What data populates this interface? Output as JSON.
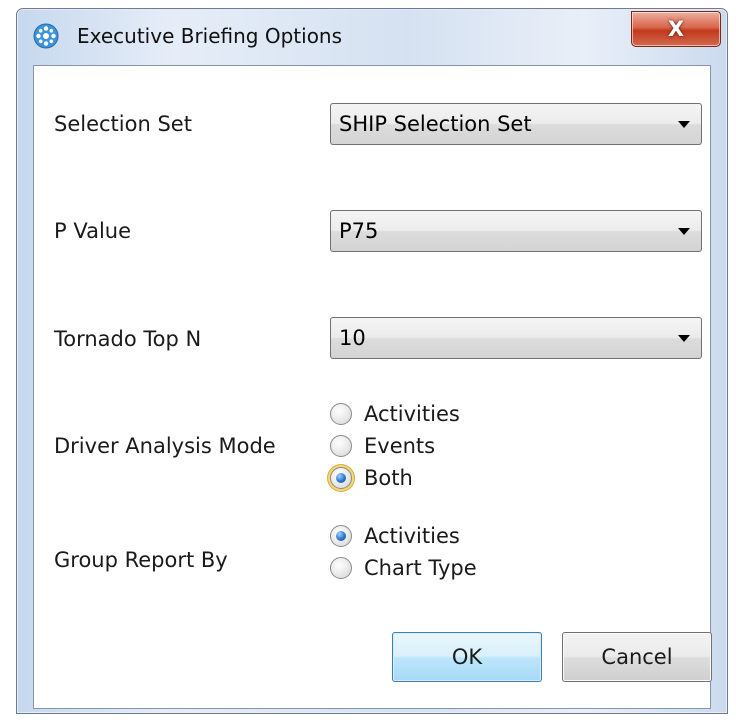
{
  "window": {
    "title": "Executive Briefing Options",
    "close_label": "X"
  },
  "form": {
    "selection_set": {
      "label": "Selection Set",
      "value": "SHIP Selection Set"
    },
    "p_value": {
      "label": "P Value",
      "value": "P75"
    },
    "tornado_top_n": {
      "label": "Tornado Top N",
      "value": "10"
    },
    "driver_analysis_mode": {
      "label": "Driver Analysis Mode",
      "options": [
        {
          "label": "Activities",
          "selected": false
        },
        {
          "label": "Events",
          "selected": false
        },
        {
          "label": "Both",
          "selected": true
        }
      ]
    },
    "group_report_by": {
      "label": "Group Report By",
      "options": [
        {
          "label": "Activities",
          "selected": true
        },
        {
          "label": "Chart Type",
          "selected": false
        }
      ]
    }
  },
  "buttons": {
    "ok_label": "OK",
    "cancel_label": "Cancel"
  },
  "colors": {
    "radio_selected": "#2a78c8",
    "close_button": "#c23a1d",
    "focus_ring": "#d9ae3d"
  }
}
